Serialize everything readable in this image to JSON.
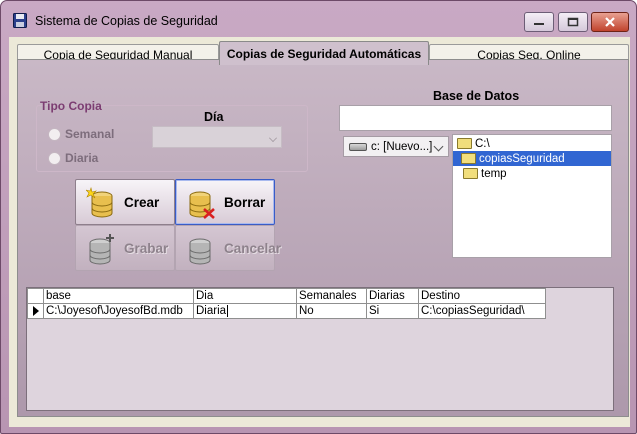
{
  "window": {
    "title": "Sistema de Copias de Seguridad"
  },
  "tabs": [
    {
      "label": "Copia de Seguridad Manual",
      "selected": false
    },
    {
      "label": "Copias de Seguridad Automáticas",
      "selected": true
    },
    {
      "label": "Copias Seg. Online",
      "selected": false
    }
  ],
  "tipo_copia": {
    "legend": "Tipo Copia",
    "dia_label": "Día",
    "options": [
      {
        "label": "Semanal",
        "checked": false
      },
      {
        "label": "Diaria",
        "checked": false
      }
    ],
    "dia_value": ""
  },
  "buttons": {
    "crear": "Crear",
    "borrar": "Borrar",
    "grabar": "Grabar",
    "cancelar": "Cancelar"
  },
  "base_datos": {
    "label": "Base de Datos",
    "value": "",
    "drive": "c: [Nuevo...]",
    "folders": [
      {
        "name": "C:\\",
        "open": true,
        "selected": false
      },
      {
        "name": "copiasSeguridad",
        "open": true,
        "selected": true
      },
      {
        "name": "temp",
        "open": false,
        "selected": false
      }
    ]
  },
  "grid": {
    "columns": [
      "base",
      "Dia",
      "Semanales",
      "Diarias",
      "Destino"
    ],
    "rows": [
      [
        "C:\\Joyesof\\JoyesofBd.mdb",
        "Diaria",
        "No",
        "Si",
        "C:\\copiasSeguridad\\"
      ]
    ]
  },
  "colors": {
    "accent": "#7c3d72",
    "selection": "#3166d2",
    "close_button": "#c1432d"
  }
}
